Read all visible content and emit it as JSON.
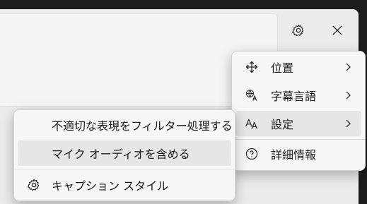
{
  "player_menu": {
    "items": [
      {
        "label": "位置",
        "icon": "move-arrows-icon"
      },
      {
        "label": "字幕言語",
        "icon": "translate-icon"
      },
      {
        "label": "設定",
        "icon": "text-style-icon"
      }
    ],
    "help": {
      "label": "詳細情報",
      "icon": "help-circle-icon"
    }
  },
  "settings_submenu": {
    "items": [
      {
        "label": "不適切な表現をフィルター処理する"
      },
      {
        "label": "マイク オーディオを含める"
      }
    ],
    "caption_style": {
      "label": "キャプション スタイル",
      "icon": "gear-icon"
    }
  },
  "window_controls": {
    "settings": "gear-icon",
    "close": "close-icon"
  }
}
